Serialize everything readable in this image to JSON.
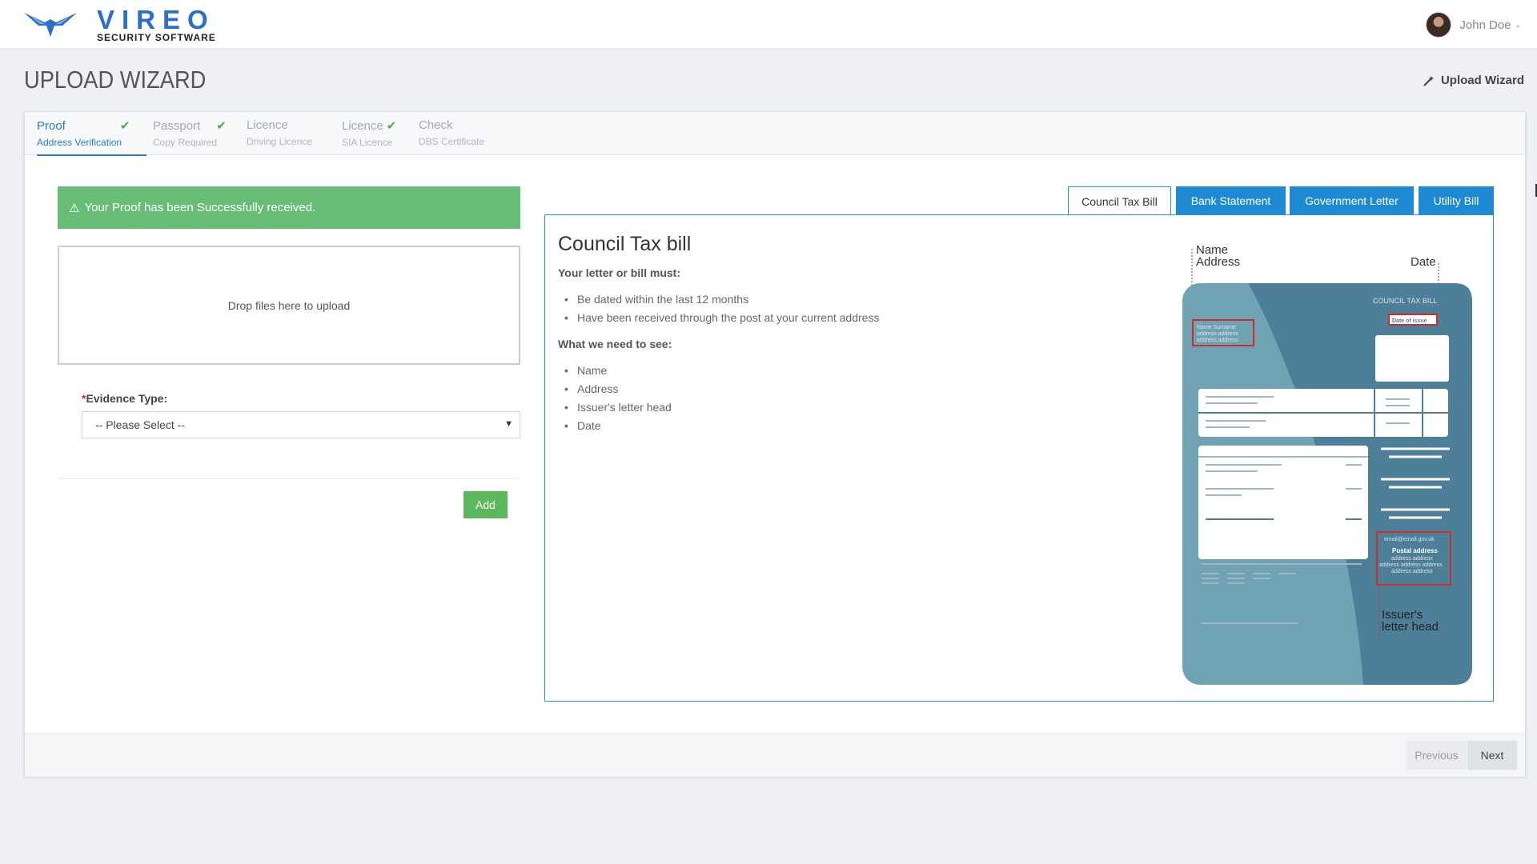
{
  "brand": {
    "name": "VIREO",
    "tagline": "SECURITY SOFTWARE"
  },
  "user": {
    "name": "John Doe",
    "dropdown_icon": "chevron-down-icon"
  },
  "page": {
    "title": "UPLOAD WIZARD",
    "breadcrumb": "Upload Wizard",
    "breadcrumb_icon": "magic-wand-icon"
  },
  "steps": [
    {
      "title": "Proof",
      "subtitle": "Address Verification",
      "done": true,
      "active": true
    },
    {
      "title": "Passport",
      "subtitle": "Copy Required",
      "done": true,
      "active": false
    },
    {
      "title": "Licence",
      "subtitle": "Driving Licence",
      "done": false,
      "active": false
    },
    {
      "title": "Licence",
      "subtitle": "SIA Licence",
      "done": true,
      "active": false
    },
    {
      "title": "Check",
      "subtitle": "DBS Certificate",
      "done": false,
      "active": false
    }
  ],
  "alert": {
    "text": "Your Proof has been Successfully received.",
    "icon": "warning-icon",
    "color": "#68bd76"
  },
  "dropzone": {
    "text": "Drop files here to upload"
  },
  "evidence": {
    "required_mark": "*",
    "label": "Evidence Type:",
    "selected": "-- Please Select --"
  },
  "add_button": "Add",
  "tabs": [
    {
      "label": "Council Tax Bill",
      "active": true
    },
    {
      "label": "Bank Statement",
      "active": false
    },
    {
      "label": "Government Letter",
      "active": false
    },
    {
      "label": "Utility Bill",
      "active": false
    }
  ],
  "content": {
    "title": "Council Tax bill",
    "must_heading": "Your letter or bill must:",
    "must_items": [
      "Be dated within the last 12 months",
      "Have been received through the post at your current address"
    ],
    "see_heading": "What we need to see:",
    "see_items": [
      "Name",
      "Address",
      "Issuer's letter head",
      "Date"
    ]
  },
  "illustration": {
    "label_name": "Name",
    "label_address": "Address",
    "label_date": "Date",
    "doc_title": "COUNCIL TAX BILL",
    "date_box": "Date of issue",
    "name_box_line1": "Name Surname",
    "name_box_line2": "address address",
    "name_box_line3": "address address",
    "email": "email@email.gov.uk",
    "postal_title": "Postal address",
    "postal_line1": "address address",
    "postal_line2": "address address address",
    "postal_line3": "address address",
    "issuer_line1": "Issuer's",
    "issuer_line2": "letter head"
  },
  "footer": {
    "previous": "Previous",
    "next": "Next"
  },
  "colors": {
    "accent": "#2a7ec9",
    "tab_blue": "#1f8ad4",
    "success": "#5cb85c",
    "doc_dark": "#4e7f98",
    "doc_light": "#6fa3b3",
    "highlight": "#c9302c"
  }
}
